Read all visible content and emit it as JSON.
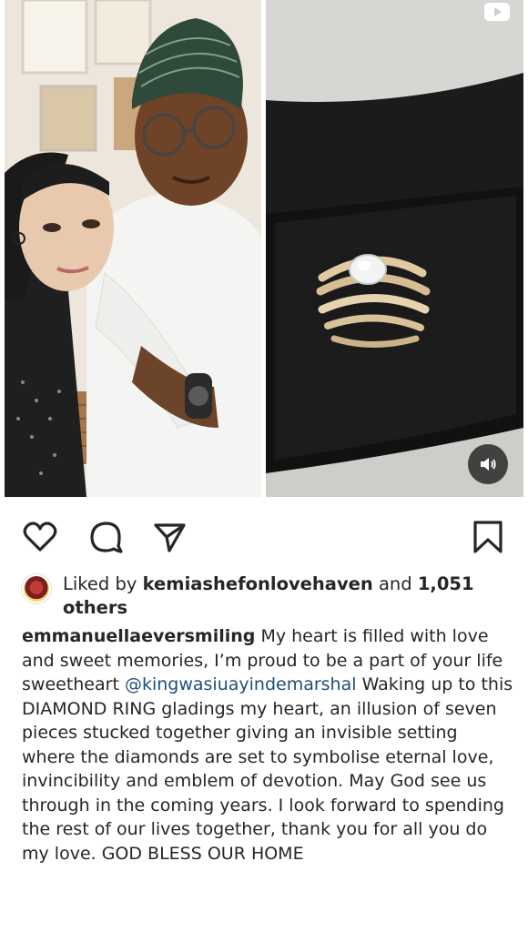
{
  "media": {
    "left_photo": "couple-selfie-photo",
    "right_video": "diamond-ring-video",
    "play_icon": "youtube-play-icon",
    "sound_icon": "speaker-icon"
  },
  "actions": {
    "like": "heart-icon",
    "comment": "comment-icon",
    "share": "send-icon",
    "save": "bookmark-icon"
  },
  "likes": {
    "prefix": "Liked by",
    "user": "kemiashefonlovehaven",
    "middle": "and",
    "count": "1,051",
    "suffix": "others"
  },
  "caption": {
    "username": "emmanuellaeversmiling",
    "text_before_mention": "My heart is filled with love and sweet memories, I’m proud to be a part of your life sweetheart",
    "mention": "@kingwasiuayindemarshal",
    "text_after_mention": "Waking up to this DIAMOND RING gladings my heart, an illusion of seven pieces stucked together giving an invisible setting where the diamonds are set to symbolise eternal love, invincibility and emblem of devotion. May God see us through in the coming years. I look forward to spending the rest of our lives together, thank you for all you do my love. GOD BLESS OUR HOME"
  },
  "colors": {
    "text": "#262626",
    "mention": "#1f4e79",
    "background": "#ffffff"
  }
}
